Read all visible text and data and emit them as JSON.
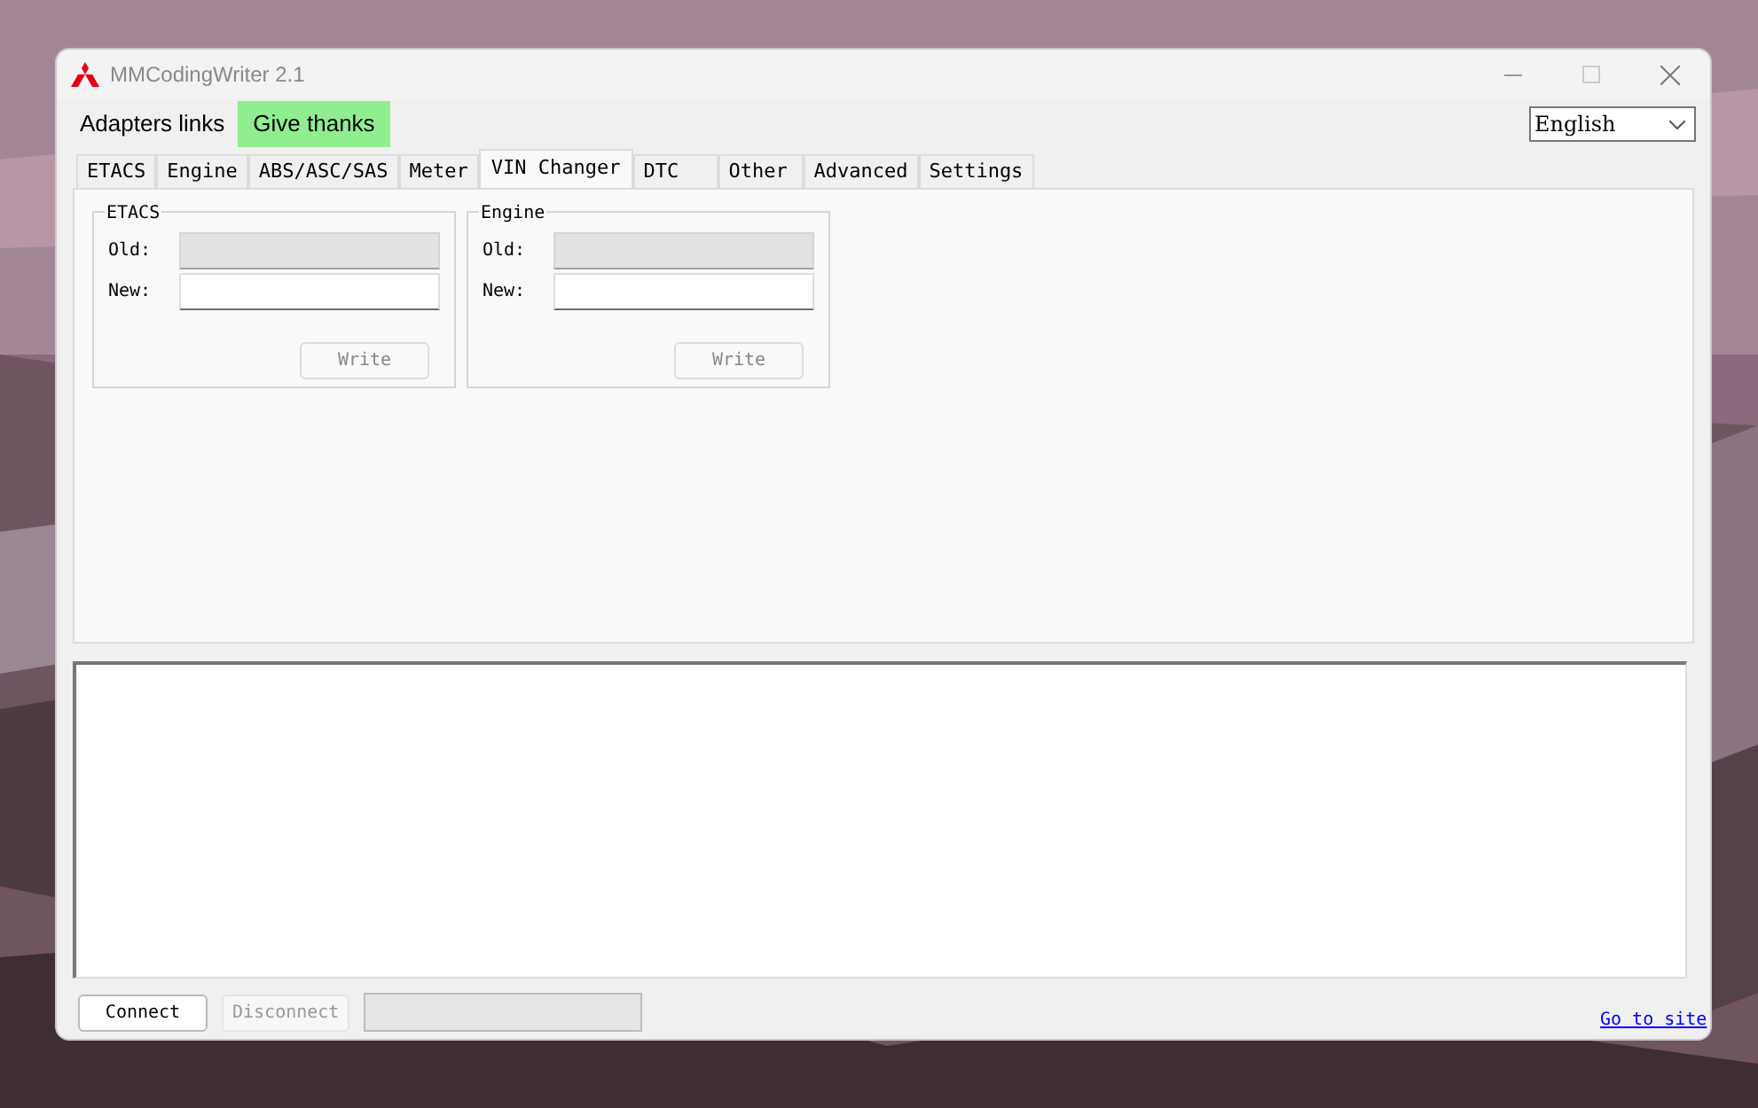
{
  "window": {
    "title": "MMCodingWriter 2.1"
  },
  "menu": [
    {
      "label": "Adapters links",
      "highlighted": false
    },
    {
      "label": "Give thanks",
      "highlighted": true
    }
  ],
  "language": {
    "value": "English"
  },
  "tabs": [
    {
      "label": "ETACS",
      "selected": false
    },
    {
      "label": "Engine",
      "selected": false
    },
    {
      "label": "ABS/ASC/SAS",
      "selected": false
    },
    {
      "label": "Meter",
      "selected": false
    },
    {
      "label": "VIN Changer",
      "selected": true
    },
    {
      "label": "DTC",
      "selected": false
    },
    {
      "label": "Other",
      "selected": false
    },
    {
      "label": "Advanced",
      "selected": false
    },
    {
      "label": "Settings",
      "selected": false
    }
  ],
  "groups": [
    {
      "title": "ETACS",
      "fields": [
        {
          "label": "Old:",
          "disabled": true
        },
        {
          "label": "New:",
          "disabled": false
        }
      ],
      "button": {
        "label": "Write",
        "disabled": true
      }
    },
    {
      "title": "Engine",
      "fields": [
        {
          "label": "Old:",
          "disabled": true
        },
        {
          "label": "New:",
          "disabled": false
        }
      ],
      "button": {
        "label": "Write",
        "disabled": true
      }
    }
  ],
  "footer": {
    "buttons": [
      {
        "label": "Connect",
        "disabled": false
      },
      {
        "label": "Disconnect",
        "disabled": true
      }
    ],
    "link": "Go to site",
    "progress": {
      "level": 0
    }
  }
}
